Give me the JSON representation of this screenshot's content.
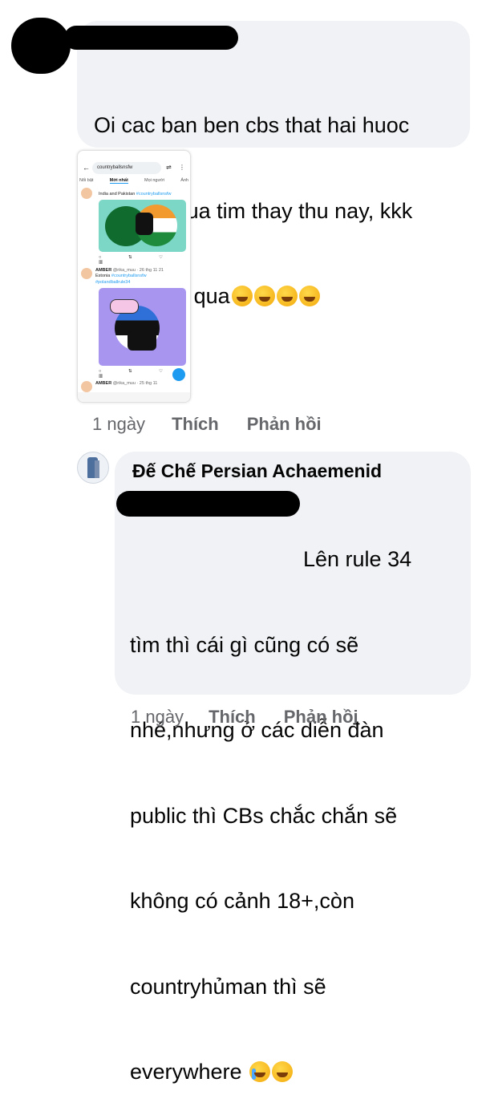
{
  "comment1": {
    "lines": [
      "Oi cac ban ben cbs that hai huoc",
      "toi cung vua tim thay thu nay, kkk",
      "buon cuoi qua"
    ],
    "emojis": [
      "rofl-emoji",
      "rofl-emoji",
      "rofl-emoji",
      "rofl-emoji"
    ],
    "time": "1 ngày",
    "like": "Thích",
    "reply": "Phản hồi"
  },
  "screenshot": {
    "search": "countryballsnsfw",
    "tabs": [
      "Nổi bật",
      "Mới nhất",
      "Mọi người",
      "Ảnh"
    ],
    "post1_text": "India and Pakistan",
    "post1_tag": "#countryballsnsfw",
    "post2_user": "AMBER",
    "post2_handle": "@rika_muu · 26 thg 11 21",
    "post2_text": "Estonia",
    "post2_tag1": "#countryballsnsfw",
    "post2_tag2": "#polandballrule34",
    "post3_user": "AMBER",
    "post3_handle": "@rika_muu · 25 thg 11"
  },
  "comment2": {
    "author": "Đế Chế Persian Achaemenid",
    "first_line_tail": "Lên rule 34",
    "lines": [
      "tìm thì cái gì cũng có sẽ",
      "nhé,nhưng ở các diễn đàn",
      "public thì CBs chắc chắn sẽ",
      "không có cảnh 18+,còn",
      "countryhủman thì sẽ",
      "everywhere"
    ],
    "emojis": [
      "crying-emoji",
      "rofl-emoji"
    ],
    "time": "1 ngày",
    "like": "Thích",
    "reply": "Phản hồi"
  },
  "colors": {
    "bubble": "#f0f2f5",
    "meta_text": "#65676b",
    "link": "#1d9bf0"
  }
}
